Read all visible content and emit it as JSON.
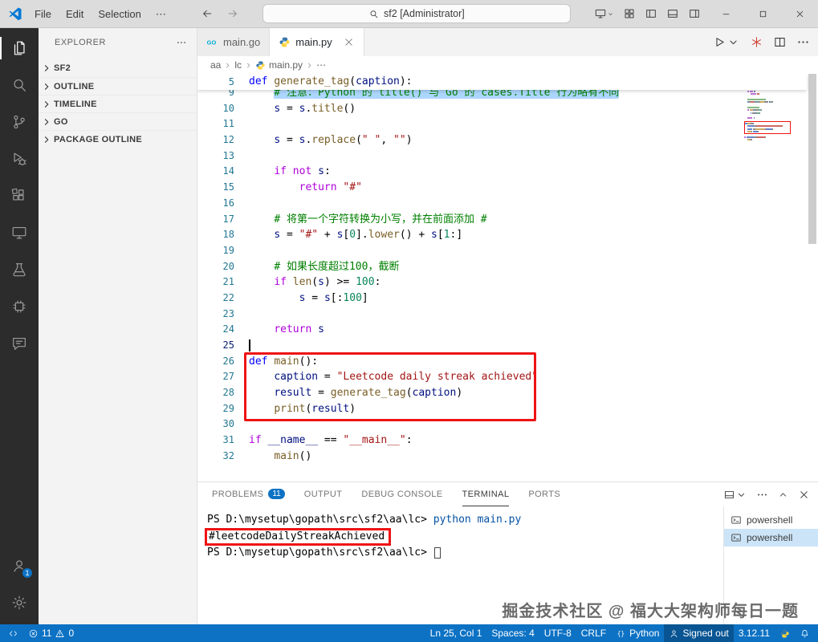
{
  "colors": {
    "accent": "#0d72c4",
    "annotation": "#ee1313",
    "selection": "#add6ff"
  },
  "title_bar": {
    "menus": [
      "File",
      "Edit",
      "Selection",
      "⋯"
    ],
    "search_text": "sf2 [Administrator]",
    "right_icons": [
      {
        "name": "layout-controls",
        "icon": "monitor",
        "chevron": true
      },
      {
        "name": "customize-layout",
        "icon": "grid"
      },
      {
        "name": "toggle-primary-sidebar",
        "icon": "sidebar-left"
      },
      {
        "name": "toggle-panel",
        "icon": "panel-bottom"
      },
      {
        "name": "toggle-secondary-sidebar",
        "icon": "sidebar-right"
      }
    ],
    "window_controls": [
      "minimize",
      "maximize",
      "close"
    ]
  },
  "activity_bar": {
    "top": [
      {
        "name": "explorer",
        "icon": "files",
        "active": true
      },
      {
        "name": "search",
        "icon": "search"
      },
      {
        "name": "source-control",
        "icon": "scm"
      },
      {
        "name": "run-and-debug",
        "icon": "debug"
      },
      {
        "name": "extensions",
        "icon": "extensions"
      },
      {
        "name": "remote-explorer",
        "icon": "monitor"
      },
      {
        "name": "testing",
        "icon": "beaker"
      },
      {
        "name": "hardware-tools",
        "icon": "chip"
      },
      {
        "name": "chat",
        "icon": "chat"
      }
    ],
    "bottom": [
      {
        "name": "accounts",
        "icon": "account",
        "badge": "1"
      },
      {
        "name": "settings",
        "icon": "gear"
      }
    ]
  },
  "sidebar": {
    "header": "EXPLORER",
    "sections": [
      {
        "label": "SF2"
      },
      {
        "label": "OUTLINE"
      },
      {
        "label": "TIMELINE"
      },
      {
        "label": "GO"
      },
      {
        "label": "PACKAGE OUTLINE"
      }
    ]
  },
  "editor": {
    "tabs": [
      {
        "label": "main.go",
        "icon": "go",
        "active": false
      },
      {
        "label": "main.py",
        "icon": "python",
        "active": true
      }
    ],
    "breadcrumb": [
      "aa",
      "lc",
      "main.py",
      "⋯"
    ],
    "actions": [
      {
        "name": "run-python-file",
        "icon": "play",
        "chevron": true
      },
      {
        "name": "extension-action",
        "icon": "asterisk",
        "color": "#d23f31"
      },
      {
        "name": "split-editor",
        "icon": "split"
      },
      {
        "name": "more-actions",
        "icon": "ellipsis"
      }
    ],
    "sticky": {
      "num": "5",
      "tokens": [
        [
          "kw",
          "def "
        ],
        [
          "fn",
          "generate_tag"
        ],
        [
          "pln",
          "("
        ],
        [
          "var",
          "caption"
        ],
        [
          "pln",
          "):"
        ]
      ]
    },
    "cursor_line": "25",
    "lines": [
      {
        "num": "9",
        "tokens": [
          [
            "pln",
            "    "
          ],
          [
            "comsel",
            "# 注意：Python 的 title() 与 Go 的 cases.Title 行为略有不同"
          ]
        ]
      },
      {
        "num": "10",
        "tokens": [
          [
            "pln",
            "    "
          ],
          [
            "var",
            "s"
          ],
          [
            "pln",
            " = "
          ],
          [
            "var",
            "s"
          ],
          [
            "pln",
            "."
          ],
          [
            "fn",
            "title"
          ],
          [
            "pln",
            "()"
          ]
        ]
      },
      {
        "num": "11",
        "tokens": []
      },
      {
        "num": "12",
        "tokens": [
          [
            "pln",
            "    "
          ],
          [
            "var",
            "s"
          ],
          [
            "pln",
            " = "
          ],
          [
            "var",
            "s"
          ],
          [
            "pln",
            "."
          ],
          [
            "fn",
            "replace"
          ],
          [
            "pln",
            "("
          ],
          [
            "str",
            "\" \""
          ],
          [
            "pln",
            ", "
          ],
          [
            "str",
            "\"\""
          ],
          [
            "pln",
            ")"
          ]
        ]
      },
      {
        "num": "13",
        "tokens": []
      },
      {
        "num": "14",
        "tokens": [
          [
            "pln",
            "    "
          ],
          [
            "ctrl",
            "if"
          ],
          [
            "pln",
            " "
          ],
          [
            "ctrl",
            "not"
          ],
          [
            "pln",
            " "
          ],
          [
            "var",
            "s"
          ],
          [
            "pln",
            ":"
          ]
        ]
      },
      {
        "num": "15",
        "tokens": [
          [
            "pln",
            "        "
          ],
          [
            "ctrl",
            "return"
          ],
          [
            "pln",
            " "
          ],
          [
            "str",
            "\"#\""
          ]
        ]
      },
      {
        "num": "16",
        "tokens": []
      },
      {
        "num": "17",
        "tokens": [
          [
            "pln",
            "    "
          ],
          [
            "com",
            "# 将第一个字符转换为小写，并在前面添加 #"
          ]
        ]
      },
      {
        "num": "18",
        "tokens": [
          [
            "pln",
            "    "
          ],
          [
            "var",
            "s"
          ],
          [
            "pln",
            " = "
          ],
          [
            "str",
            "\"#\""
          ],
          [
            "pln",
            " + "
          ],
          [
            "var",
            "s"
          ],
          [
            "pln",
            "["
          ],
          [
            "num",
            "0"
          ],
          [
            "pln",
            "]."
          ],
          [
            "fn",
            "lower"
          ],
          [
            "pln",
            "() + "
          ],
          [
            "var",
            "s"
          ],
          [
            "pln",
            "["
          ],
          [
            "num",
            "1"
          ],
          [
            "pln",
            ":]"
          ]
        ]
      },
      {
        "num": "19",
        "tokens": []
      },
      {
        "num": "20",
        "tokens": [
          [
            "pln",
            "    "
          ],
          [
            "com",
            "# 如果长度超过100，截断"
          ]
        ]
      },
      {
        "num": "21",
        "tokens": [
          [
            "pln",
            "    "
          ],
          [
            "ctrl",
            "if"
          ],
          [
            "pln",
            " "
          ],
          [
            "fn",
            "len"
          ],
          [
            "pln",
            "("
          ],
          [
            "var",
            "s"
          ],
          [
            "pln",
            ") >= "
          ],
          [
            "num",
            "100"
          ],
          [
            "pln",
            ":"
          ]
        ]
      },
      {
        "num": "22",
        "tokens": [
          [
            "pln",
            "        "
          ],
          [
            "var",
            "s"
          ],
          [
            "pln",
            " = "
          ],
          [
            "var",
            "s"
          ],
          [
            "pln",
            "[:"
          ],
          [
            "num",
            "100"
          ],
          [
            "pln",
            "]"
          ]
        ]
      },
      {
        "num": "23",
        "tokens": []
      },
      {
        "num": "24",
        "tokens": [
          [
            "pln",
            "    "
          ],
          [
            "ctrl",
            "return"
          ],
          [
            "pln",
            " "
          ],
          [
            "var",
            "s"
          ]
        ]
      },
      {
        "num": "25",
        "tokens": []
      },
      {
        "num": "26",
        "tokens": [
          [
            "kw",
            "def "
          ],
          [
            "fn",
            "main"
          ],
          [
            "pln",
            "():"
          ]
        ]
      },
      {
        "num": "27",
        "tokens": [
          [
            "pln",
            "    "
          ],
          [
            "var",
            "caption"
          ],
          [
            "pln",
            " = "
          ],
          [
            "str",
            "\"Leetcode daily streak achieved\""
          ]
        ]
      },
      {
        "num": "28",
        "tokens": [
          [
            "pln",
            "    "
          ],
          [
            "var",
            "result"
          ],
          [
            "pln",
            " = "
          ],
          [
            "fn",
            "generate_tag"
          ],
          [
            "pln",
            "("
          ],
          [
            "var",
            "caption"
          ],
          [
            "pln",
            ")"
          ]
        ]
      },
      {
        "num": "29",
        "tokens": [
          [
            "pln",
            "    "
          ],
          [
            "fn",
            "print"
          ],
          [
            "pln",
            "("
          ],
          [
            "var",
            "result"
          ],
          [
            "pln",
            ")"
          ]
        ]
      },
      {
        "num": "30",
        "tokens": []
      },
      {
        "num": "31",
        "tokens": [
          [
            "ctrl",
            "if"
          ],
          [
            "pln",
            " "
          ],
          [
            "var",
            "__name__"
          ],
          [
            "pln",
            " == "
          ],
          [
            "str",
            "\"__main__\""
          ],
          [
            "pln",
            ":"
          ]
        ]
      },
      {
        "num": "32",
        "tokens": [
          [
            "pln",
            "    "
          ],
          [
            "fn",
            "main"
          ],
          [
            "pln",
            "()"
          ]
        ]
      }
    ]
  },
  "panel": {
    "tabs": [
      {
        "label": "PROBLEMS",
        "badge": "11"
      },
      {
        "label": "OUTPUT"
      },
      {
        "label": "DEBUG CONSOLE"
      },
      {
        "label": "TERMINAL",
        "active": true
      },
      {
        "label": "PORTS"
      }
    ],
    "actions": [
      {
        "name": "terminal-views",
        "icon": "panel-bottom",
        "chevron": true
      },
      {
        "name": "more-actions",
        "icon": "ellipsis"
      },
      {
        "name": "maximize-panel",
        "icon": "chevron-up"
      },
      {
        "name": "close-panel",
        "icon": "close"
      }
    ],
    "terminal": {
      "lines": [
        {
          "tokens": [
            [
              "pln",
              "PS D:\\mysetup\\gopath\\src\\sf2\\aa\\lc> "
            ],
            [
              "cmd",
              "python main.py"
            ]
          ]
        },
        {
          "tokens": [
            [
              "pln",
              "#leetcodeDailyStreakAchieved"
            ]
          ],
          "boxed": true
        },
        {
          "tokens": [
            [
              "pln",
              "PS D:\\mysetup\\gopath\\src\\sf2\\aa\\lc> "
            ]
          ],
          "cursor": true
        }
      ]
    },
    "terminal_list": [
      {
        "label": "powershell",
        "active": false
      },
      {
        "label": "powershell",
        "active": true
      }
    ]
  },
  "watermark": "掘金技术社区 @ 福大大架构师每日一题",
  "status_bar": {
    "problems": {
      "errors": "11",
      "warnings": "0"
    },
    "right_items": [
      {
        "name": "cursor-position",
        "text": "Ln 25, Col 1"
      },
      {
        "name": "indentation",
        "text": "Spaces: 4"
      },
      {
        "name": "encoding",
        "text": "UTF-8"
      },
      {
        "name": "eol",
        "text": "CRLF"
      },
      {
        "name": "language-mode",
        "text": "Python",
        "icon": "braces"
      },
      {
        "name": "signed-out",
        "text": "Signed out",
        "icon": "person",
        "emphasized": true
      },
      {
        "name": "python-version",
        "text": "3.12.11"
      },
      {
        "name": "python-extension",
        "icon": "python"
      },
      {
        "name": "notifications",
        "icon": "bell"
      }
    ]
  }
}
